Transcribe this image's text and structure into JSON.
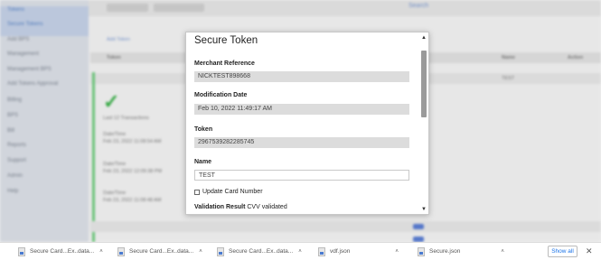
{
  "modal": {
    "title": "Secure Token",
    "fields": [
      {
        "label": "Merchant Reference",
        "value": "NICKTEST898668",
        "editable": false
      },
      {
        "label": "Modification Date",
        "value": "Feb 10, 2022 11:49:17 AM",
        "editable": false
      },
      {
        "label": "Token",
        "value": "2967539282285745",
        "editable": false
      },
      {
        "label": "Name",
        "value": "TEST",
        "editable": true
      }
    ],
    "update_card_label": "Update Card Number",
    "validation_label": "Validation Result",
    "validation_value": "CVV validated"
  },
  "background": {
    "column_headers": [
      "Token",
      "Name",
      "Action"
    ],
    "sidebar_items": [
      "Tokens",
      "Secure Tokens",
      "Add BPS",
      "Management",
      "Management BPS",
      "Add Tokens Approval",
      "Billing",
      "BPS",
      "Bill",
      "Reports",
      "Support",
      "Admin",
      "Help"
    ],
    "status_label": "Last 12 Transactions",
    "time_label": "Date/Time",
    "row_dates": [
      "Feb 23, 2022 11:08:54 AM",
      "Feb 23, 2022 12:09:38 PM",
      "Feb 23, 2022 11:08:48 AM"
    ],
    "row_label": "TEST",
    "add_button": "Add Token"
  },
  "download_bar": {
    "items": [
      "Secure Card...Ex..data...",
      "Secure Card...Ex..data...",
      "Secure Card...Ex..data...",
      "vdf.json",
      "Secure.json"
    ],
    "show_all_label": "Show all",
    "colors": {
      "accent": "#1a73e8"
    }
  }
}
